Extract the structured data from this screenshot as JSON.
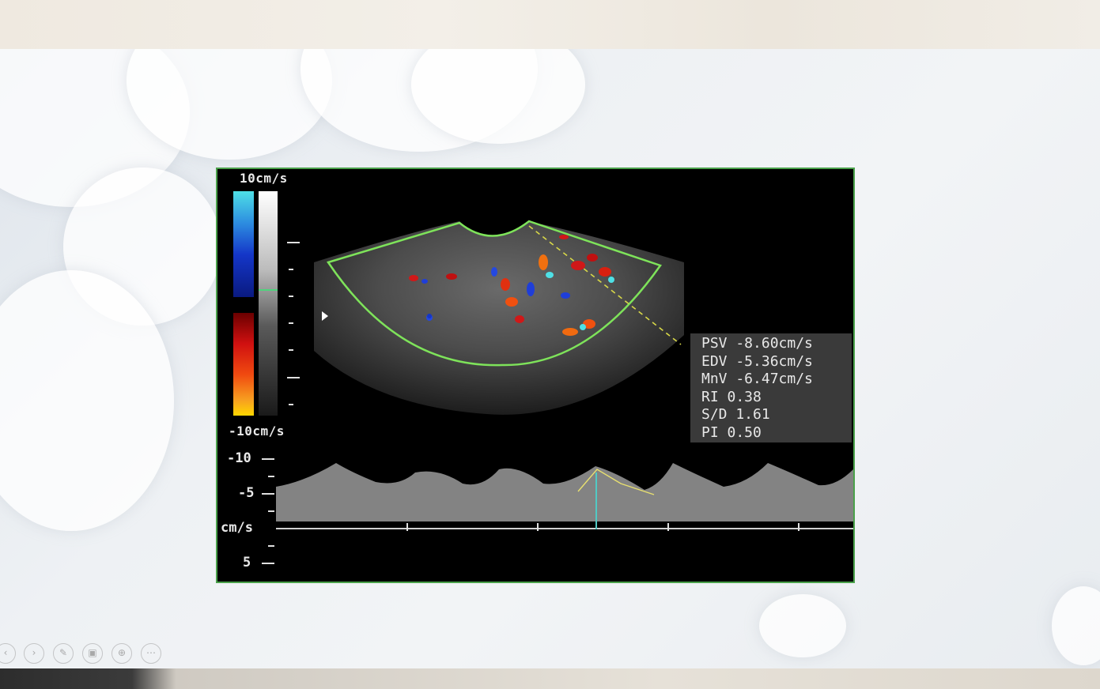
{
  "colors": {
    "panel_border": "#4aa14a",
    "roi_outline": "#7ee35a",
    "param_box_bg": "#3a3a3a",
    "cursor_line": "#52c9c4"
  },
  "ultrasound": {
    "velocity_scale": {
      "top_label": "10cm/s",
      "bottom_label": "-10cm/s"
    },
    "measurements": [
      "PSV -8.60cm/s",
      "EDV -5.36cm/s",
      "MnV -6.47cm/s",
      "RI 0.38",
      "S/D 1.61",
      "PI 0.50"
    ],
    "spectral_axis": {
      "labels": [
        "-10",
        "-5",
        "cm/s",
        "5"
      ]
    }
  },
  "toolbar": {
    "buttons": [
      {
        "name": "previous-slide-icon",
        "glyph": "‹"
      },
      {
        "name": "next-slide-icon",
        "glyph": "›"
      },
      {
        "name": "pen-icon",
        "glyph": "✎"
      },
      {
        "name": "slides-overview-icon",
        "glyph": "▣"
      },
      {
        "name": "zoom-icon",
        "glyph": "⊕"
      },
      {
        "name": "more-options-icon",
        "glyph": "⋯"
      }
    ]
  }
}
